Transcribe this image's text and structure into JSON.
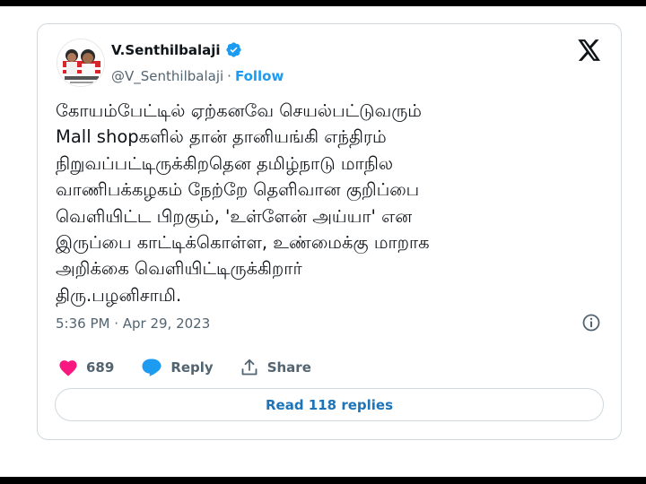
{
  "author": {
    "display_name": "V.Senthilbalaji",
    "handle": "@V_Senthilbalaji",
    "separator": "·",
    "follow_label": "Follow"
  },
  "tweet": {
    "text": "கோயம்பேட்டில் ஏற்கனவே செயல்பட்டுவரும்\nMall shopகளில் தான் தானியங்கி எந்திரம்\nநிறுவப்பட்டிருக்கிறதென தமிழ்நாடு மாநில\nவாணிபக்கழகம் நேற்றே தெளிவான குறிப்பை\nவெளியிட்ட பிறகும், 'உள்ளேன் அய்யா' என\nஇருப்பை காட்டிக்கொள்ள, உண்மைக்கு மாறாக\nஅறிக்கை வெளியிட்டிருக்கிறார்\nதிரு.பழனிசாமி.",
    "timestamp": "5:36 PM · Apr 29, 2023"
  },
  "actions": {
    "like_count": "689",
    "reply_label": "Reply",
    "share_label": "Share"
  },
  "read_replies_label": "Read 118 replies",
  "colors": {
    "accent": "#1d9bf0",
    "like": "#f91880",
    "reply_icon": "#1d9bf0",
    "muted": "#536471",
    "border": "#cfd9de"
  }
}
